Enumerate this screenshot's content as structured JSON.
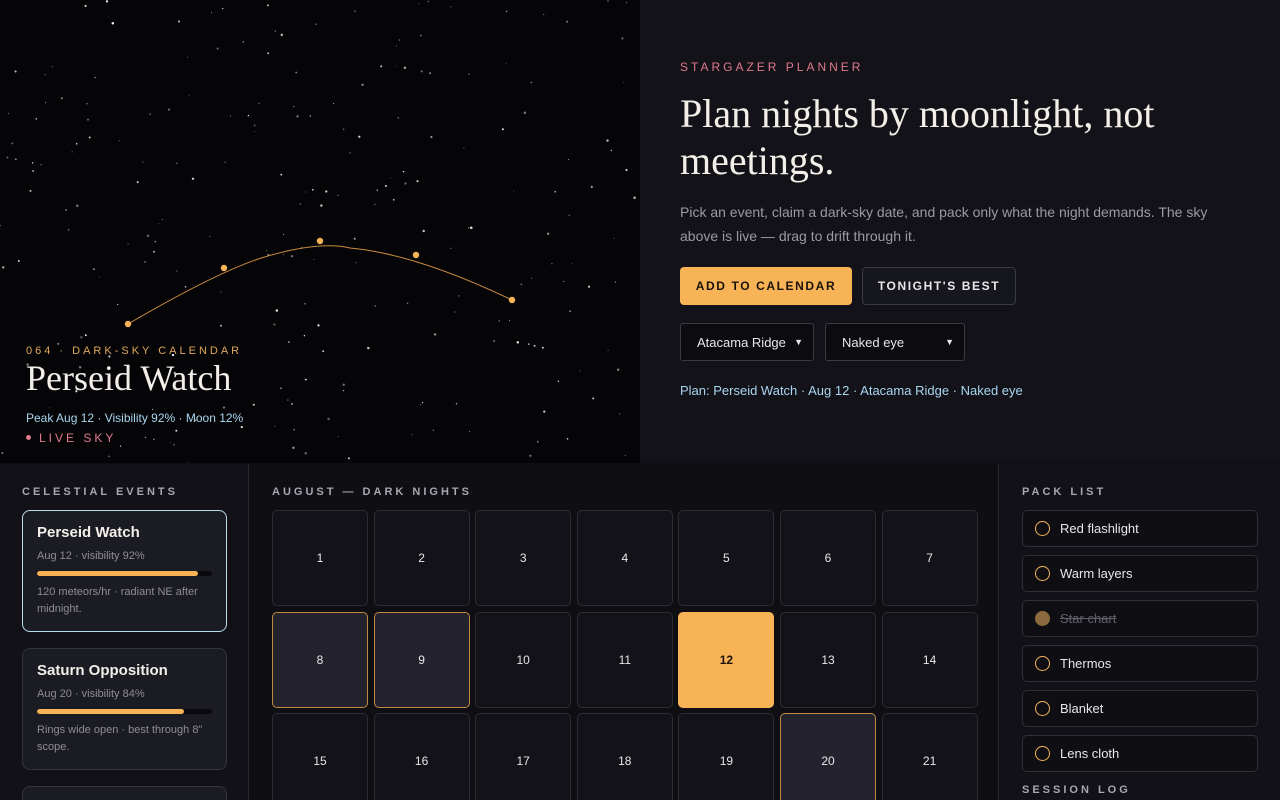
{
  "hero": {
    "event_eyebrow": "064 · DARK-SKY CALENDAR",
    "event_title": "Perseid Watch",
    "event_meta": "Peak Aug 12 · Visibility 92% · Moon 12%",
    "live_label": "LIVE SKY"
  },
  "intro": {
    "brand": "STARGAZER PLANNER",
    "headline": "Plan nights by moonlight, not meetings.",
    "lede": "Pick an event, claim a dark-sky date, and pack only what the night demands. The sky above is live — drag to drift through it.",
    "primary_button": "ADD TO CALENDAR",
    "secondary_button": "TONIGHT'S BEST",
    "site_select": "Atacama Ridge",
    "optics_select": "Naked eye",
    "plan_summary": "Plan: Perseid Watch · Aug 12 · Atacama Ridge · Naked eye"
  },
  "events": {
    "label": "CELESTIAL EVENTS",
    "items": [
      {
        "title": "Perseid Watch",
        "sub": "Aug 12 · visibility 92%",
        "visibility": 0.92,
        "note": "120 meteors/hr · radiant NE after midnight.",
        "active": true
      },
      {
        "title": "Saturn Opposition",
        "sub": "Aug 20 · visibility 84%",
        "visibility": 0.84,
        "note": "Rings wide open · best through 8\" scope.",
        "active": false
      }
    ]
  },
  "calendar": {
    "label": "AUGUST — DARK NIGHTS",
    "days": [
      {
        "n": "1",
        "s": ""
      },
      {
        "n": "2",
        "s": ""
      },
      {
        "n": "3",
        "s": ""
      },
      {
        "n": "4",
        "s": ""
      },
      {
        "n": "5",
        "s": ""
      },
      {
        "n": "6",
        "s": ""
      },
      {
        "n": "7",
        "s": ""
      },
      {
        "n": "8",
        "s": "dark"
      },
      {
        "n": "9",
        "s": "dark"
      },
      {
        "n": "10",
        "s": ""
      },
      {
        "n": "11",
        "s": ""
      },
      {
        "n": "12",
        "s": "peak"
      },
      {
        "n": "13",
        "s": ""
      },
      {
        "n": "14",
        "s": ""
      },
      {
        "n": "15",
        "s": ""
      },
      {
        "n": "16",
        "s": ""
      },
      {
        "n": "17",
        "s": ""
      },
      {
        "n": "18",
        "s": ""
      },
      {
        "n": "19",
        "s": ""
      },
      {
        "n": "20",
        "s": "dark"
      },
      {
        "n": "21",
        "s": ""
      }
    ]
  },
  "pack": {
    "label": "PACK LIST",
    "items": [
      {
        "label": "Red flashlight",
        "done": false
      },
      {
        "label": "Warm layers",
        "done": false
      },
      {
        "label": "Star chart",
        "done": true
      },
      {
        "label": "Thermos",
        "done": false
      },
      {
        "label": "Blanket",
        "done": false
      },
      {
        "label": "Lens cloth",
        "done": false
      }
    ],
    "log_label": "SESSION LOG"
  },
  "colors": {
    "accent": "#f7b356",
    "rose": "#e07a8c",
    "sky_text": "#a9d6f0"
  }
}
